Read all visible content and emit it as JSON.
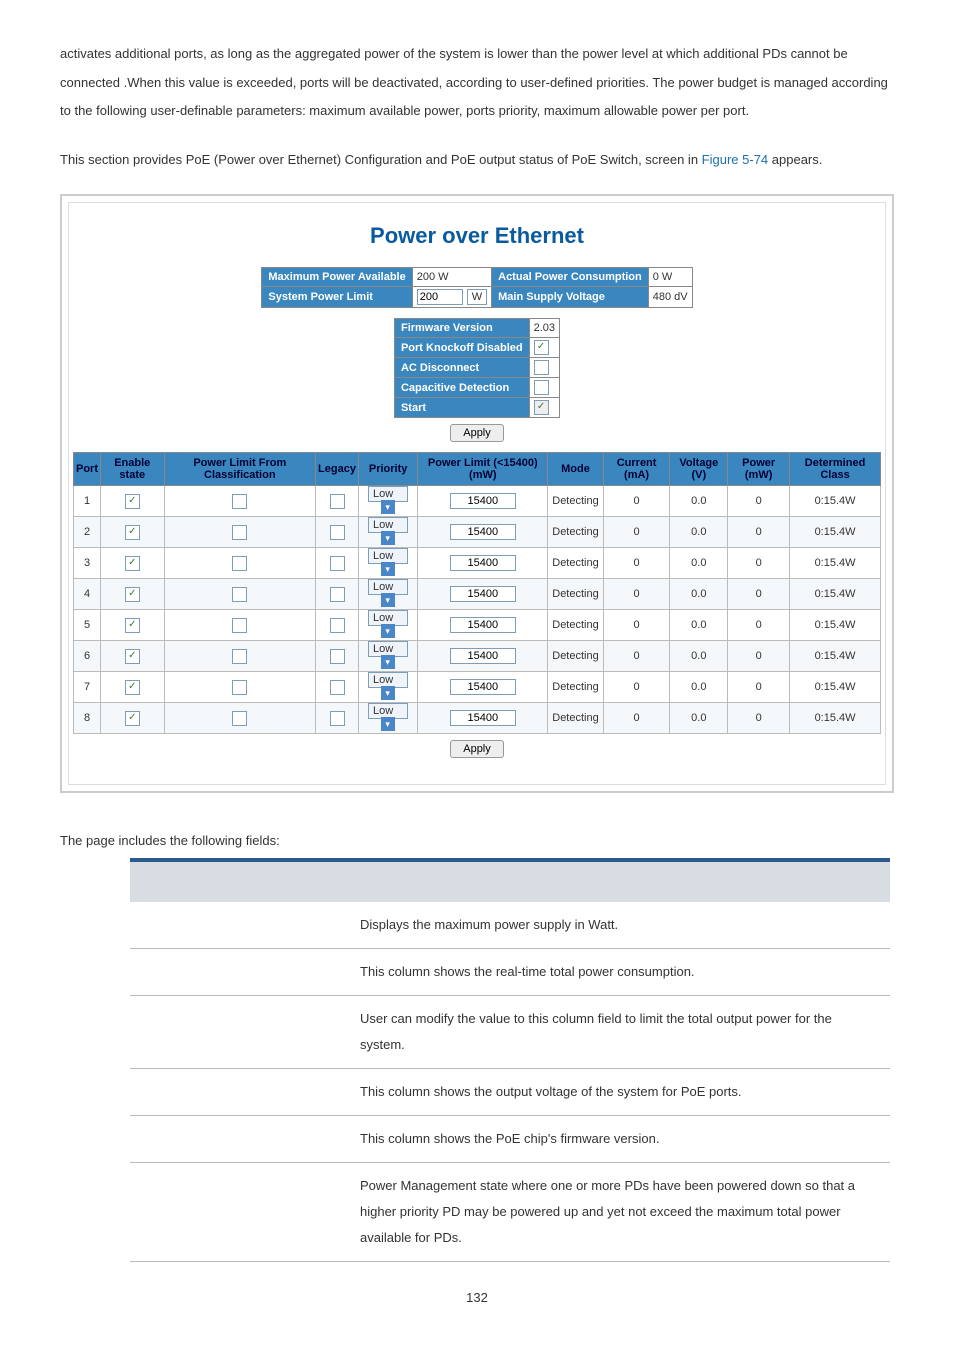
{
  "intro_p1": "activates additional ports, as long as the aggregated power of the system is lower than the power level at which additional PDs cannot be connected .When this value is exceeded, ports will be deactivated, according to user-defined priorities. The power budget is managed according to the following user-definable parameters: maximum available power, ports priority, maximum allowable power per port.",
  "intro_p2a": "This section provides PoE (Power over Ethernet) Configuration and PoE output status of PoE Switch, screen in ",
  "intro_link": "Figure 5-74",
  "intro_p2b": " appears.",
  "fig": {
    "title": "Power over Ethernet",
    "summary": {
      "max_power_lbl": "Maximum Power Available",
      "max_power_val": "200 W",
      "actual_lbl": "Actual Power Consumption",
      "actual_val": "0 W",
      "spl_lbl": "System Power Limit",
      "spl_val": "200",
      "spl_unit": "W",
      "msv_lbl": "Main Supply Voltage",
      "msv_val": "480 dV"
    },
    "status": {
      "fw_lbl": "Firmware Version",
      "fw_val": "2.03",
      "pk_lbl": "Port Knockoff Disabled",
      "pk_checked": true,
      "ac_lbl": "AC Disconnect",
      "ac_checked": false,
      "cap_lbl": "Capacitive Detection",
      "cap_checked": false,
      "start_lbl": "Start",
      "start_checked": true,
      "start_disabled": true
    },
    "apply": "Apply",
    "cols": {
      "port": "Port",
      "enable": "Enable state",
      "plfc": "Power Limit From Classification",
      "legacy": "Legacy",
      "priority": "Priority",
      "plimit": "Power Limit (<15400) (mW)",
      "mode": "Mode",
      "current": "Current (mA)",
      "voltage": "Voltage (V)",
      "power": "Power (mW)",
      "det": "Determined Class"
    },
    "rows": [
      {
        "port": "1",
        "enable": true,
        "plfc": false,
        "legacy": false,
        "priority": "Low",
        "plimit": "15400",
        "mode": "Detecting",
        "current": "0",
        "voltage": "0.0",
        "power": "0",
        "det": "0:15.4W"
      },
      {
        "port": "2",
        "enable": true,
        "plfc": false,
        "legacy": false,
        "priority": "Low",
        "plimit": "15400",
        "mode": "Detecting",
        "current": "0",
        "voltage": "0.0",
        "power": "0",
        "det": "0:15.4W"
      },
      {
        "port": "3",
        "enable": true,
        "plfc": false,
        "legacy": false,
        "priority": "Low",
        "plimit": "15400",
        "mode": "Detecting",
        "current": "0",
        "voltage": "0.0",
        "power": "0",
        "det": "0:15.4W"
      },
      {
        "port": "4",
        "enable": true,
        "plfc": false,
        "legacy": false,
        "priority": "Low",
        "plimit": "15400",
        "mode": "Detecting",
        "current": "0",
        "voltage": "0.0",
        "power": "0",
        "det": "0:15.4W"
      },
      {
        "port": "5",
        "enable": true,
        "plfc": false,
        "legacy": false,
        "priority": "Low",
        "plimit": "15400",
        "mode": "Detecting",
        "current": "0",
        "voltage": "0.0",
        "power": "0",
        "det": "0:15.4W"
      },
      {
        "port": "6",
        "enable": true,
        "plfc": false,
        "legacy": false,
        "priority": "Low",
        "plimit": "15400",
        "mode": "Detecting",
        "current": "0",
        "voltage": "0.0",
        "power": "0",
        "det": "0:15.4W"
      },
      {
        "port": "7",
        "enable": true,
        "plfc": false,
        "legacy": false,
        "priority": "Low",
        "plimit": "15400",
        "mode": "Detecting",
        "current": "0",
        "voltage": "0.0",
        "power": "0",
        "det": "0:15.4W"
      },
      {
        "port": "8",
        "enable": true,
        "plfc": false,
        "legacy": false,
        "priority": "Low",
        "plimit": "15400",
        "mode": "Detecting",
        "current": "0",
        "voltage": "0.0",
        "power": "0",
        "det": "0:15.4W"
      }
    ],
    "apply2": "Apply"
  },
  "fields_caption": "The page includes the following fields:",
  "fields": [
    {
      "v": "Displays the maximum power supply in Watt."
    },
    {
      "v": "This column shows the real-time total power consumption."
    },
    {
      "v": "User can modify the value to this column field to limit the total output power for the system."
    },
    {
      "v": "This column shows the output voltage of the system for PoE ports."
    },
    {
      "v": "This column shows the PoE chip's firmware version."
    },
    {
      "v": "Power Management state where one or more PDs have been powered down so that a higher priority PD may be powered up and yet not exceed the maximum total power available for PDs."
    }
  ],
  "pagenum": "132"
}
